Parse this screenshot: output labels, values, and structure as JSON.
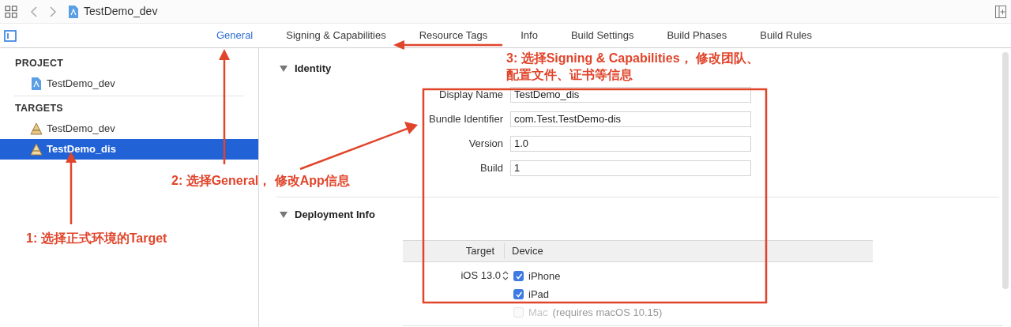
{
  "toolbar": {
    "file": "TestDemo_dev"
  },
  "tabs": [
    {
      "label": "General",
      "selected": true
    },
    {
      "label": "Signing & Capabilities",
      "selected": false
    },
    {
      "label": "Resource Tags",
      "selected": false
    },
    {
      "label": "Info",
      "selected": false
    },
    {
      "label": "Build Settings",
      "selected": false
    },
    {
      "label": "Build Phases",
      "selected": false
    },
    {
      "label": "Build Rules",
      "selected": false
    }
  ],
  "sidebar": {
    "sections": [
      {
        "heading": "PROJECT",
        "items": [
          {
            "label": "TestDemo_dev",
            "kind": "project",
            "selected": false
          }
        ]
      },
      {
        "heading": "TARGETS",
        "items": [
          {
            "label": "TestDemo_dev",
            "kind": "target",
            "selected": false
          },
          {
            "label": "TestDemo_dis",
            "kind": "target",
            "selected": true
          }
        ]
      }
    ]
  },
  "identity": {
    "title": "Identity",
    "expanded": true,
    "fields": [
      {
        "label": "Display Name",
        "value": "TestDemo_dis"
      },
      {
        "label": "Bundle Identifier",
        "value": "com.Test.TestDemo-dis"
      },
      {
        "label": "Version",
        "value": "1.0"
      },
      {
        "label": "Build",
        "value": "1"
      }
    ]
  },
  "deployment": {
    "title": "Deployment Info",
    "expanded": true,
    "columns": [
      "Target",
      "Device"
    ],
    "target": "iOS 13.0",
    "devices": [
      {
        "label": "iPhone",
        "checked": true,
        "disabled": false
      },
      {
        "label": "iPad",
        "checked": true,
        "disabled": false
      },
      {
        "label": "Mac",
        "note": "(requires macOS 10.15)",
        "checked": false,
        "disabled": true
      }
    ]
  },
  "annotations": [
    {
      "lines": [
        "1: 选择正式环境的Target"
      ]
    },
    {
      "lines": [
        "2: 选择General， 修改App信息"
      ]
    },
    {
      "lines": [
        "3: 选择Signing & Capabilities， 修改团队、",
        "配置文件、证书等信息"
      ]
    }
  ]
}
